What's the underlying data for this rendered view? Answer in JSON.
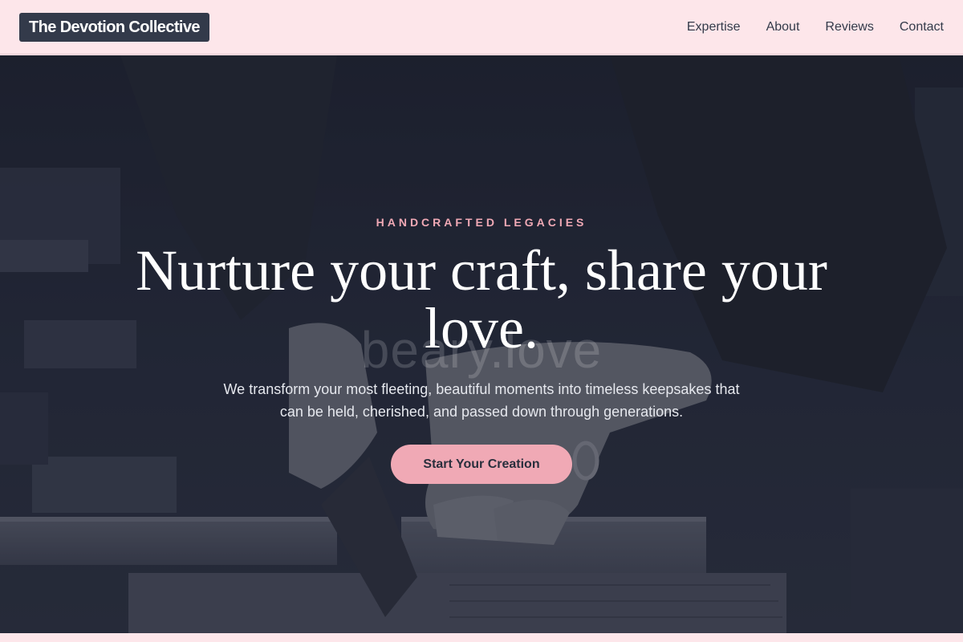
{
  "nav": {
    "brand": "The Devotion Collective",
    "links": [
      "Expertise",
      "About",
      "Reviews",
      "Contact"
    ]
  },
  "hero": {
    "eyebrow": "HANDCRAFTED LEGACIES",
    "watermark": "beary.love",
    "headline": "Nurture your craft, share your love.",
    "subtext": "We transform your most fleeting, beautiful moments into timeless keepsakes that can be held, cherished, and passed down through generations.",
    "cta": "Start Your Creation"
  },
  "colors": {
    "nav_bg": "#fde6ea",
    "brand_bg": "#333a4a",
    "accent_pink": "#f0a9b5",
    "hero_overlay": "#1f2331",
    "text_dark": "#333a4a"
  }
}
